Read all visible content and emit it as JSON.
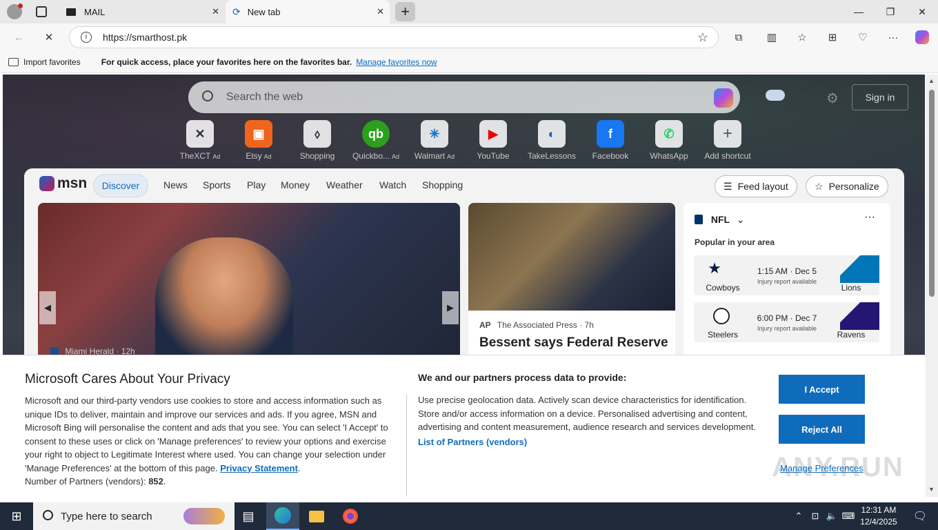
{
  "tabs": [
    {
      "label": "MAIL"
    },
    {
      "label": "New tab"
    }
  ],
  "address": {
    "url": "https://smarthost.pk"
  },
  "favbar": {
    "import_label": "Import favorites",
    "message": "For quick access, place your favorites here on the favorites bar.",
    "manage_link": "Manage favorites now"
  },
  "search": {
    "placeholder": "Search the web"
  },
  "signin": "Sign in",
  "shortcuts": [
    {
      "label": "TheXCT",
      "ad": "Ad"
    },
    {
      "label": "Etsy",
      "ad": "Ad"
    },
    {
      "label": "Shopping",
      "ad": ""
    },
    {
      "label": "Quickbo...",
      "ad": "Ad"
    },
    {
      "label": "Walmart",
      "ad": "Ad"
    },
    {
      "label": "YouTube",
      "ad": ""
    },
    {
      "label": "TakeLessons",
      "ad": ""
    },
    {
      "label": "Facebook",
      "ad": ""
    },
    {
      "label": "WhatsApp",
      "ad": ""
    },
    {
      "label": "Add shortcut",
      "ad": ""
    }
  ],
  "feed": {
    "logo": "msn",
    "nav": [
      "Discover",
      "News",
      "Sports",
      "Play",
      "Money",
      "Weather",
      "Watch",
      "Shopping"
    ],
    "feed_layout": "Feed layout",
    "personalize": "Personalize",
    "hero_source": "Miami Herald",
    "hero_time": "12h",
    "card2_source": "The Associated Press",
    "card2_time": "7h",
    "card2_title": "Bessent says Federal Reserve",
    "nfl": {
      "title": "NFL",
      "subtitle": "Popular in your area",
      "games": [
        {
          "team1": "Cowboys",
          "team2": "Lions",
          "time": "1:15 AM · Dec 5",
          "note": "Injury report available"
        },
        {
          "team1": "Steelers",
          "team2": "Ravens",
          "time": "6:00 PM · Dec 7",
          "note": "Injury report available"
        }
      ]
    }
  },
  "privacy": {
    "title": "Microsoft Cares About Your Privacy",
    "body": "Microsoft and our third-party vendors use cookies to store and access information such as unique IDs to deliver, maintain and improve our services and ads. If you agree, MSN and Microsoft Bing will personalise the content and ads that you see. You can select 'I Accept' to consent to these uses or click on 'Manage preferences' to review your options and exercise your right to object to Legitimate Interest where used.  You can change your selection under 'Manage Preferences' at the bottom of this page.",
    "privacy_link": "Privacy Statement",
    "partners_count_label": "Number of Partners (vendors):",
    "partners_count": "852",
    "process_title": "We and our partners process data to provide:",
    "purposes": "Use precise geolocation data. Actively scan device characteristics for identification. Store and/or access information on a device. Personalised advertising and content, advertising and content measurement, audience research and services development.",
    "partners_link": "List of Partners (vendors)",
    "accept": "I Accept",
    "reject": "Reject All",
    "manage": "Manage Preferences"
  },
  "watermark": "ANY.RUN",
  "taskbar": {
    "search_placeholder": "Type here to search",
    "time": "12:31 AM",
    "date": "12/4/2025"
  }
}
